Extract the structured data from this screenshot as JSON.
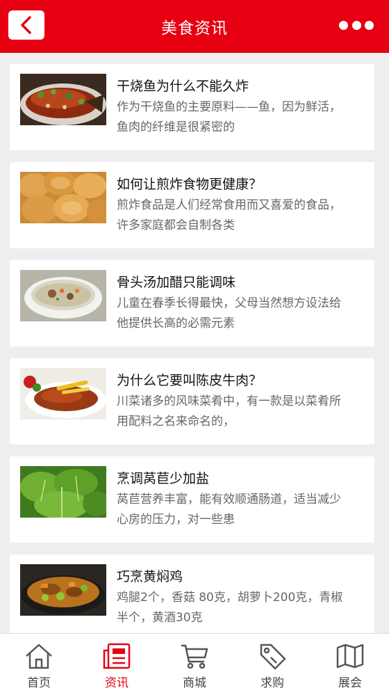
{
  "header": {
    "title": "美食资讯",
    "back_icon": "chevron-left-icon",
    "more_icon": "more-dots-icon"
  },
  "articles": [
    {
      "title": "干烧鱼为什么不能久炸",
      "desc": "作为干烧鱼的主要原料——鱼，因为鲜活，鱼肉的纤维是很紧密的",
      "image": "braised-fish-photo"
    },
    {
      "title": "如何让煎炸食物更健康？",
      "desc": "煎炸食品是人们经常食用而又喜爱的食品，许多家庭都会自制各类",
      "image": "fried-food-photo"
    },
    {
      "title": "骨头汤加醋只能调味",
      "desc": "儿童在春季长得最快，父母当然想方设法给他提供长高的必需元素",
      "image": "bone-soup-photo"
    },
    {
      "title": "为什么它要叫陈皮牛肉？",
      "desc": "川菜诸多的风味菜肴中，有一款是以菜肴所用配料之名来命名的，",
      "image": "tangerine-beef-photo"
    },
    {
      "title": "烹调莴苣少加盐",
      "desc": "莴苣营养丰富，能有效顺通肠道，适当减少心房的压力，对一些患",
      "image": "lettuce-photo"
    },
    {
      "title": "巧烹黄焖鸡",
      "desc": "鸡腿2个，香菇 80克，胡萝卜200克，青椒半个，黄酒30克",
      "image": "braised-chicken-photo"
    }
  ],
  "bottom_nav": [
    {
      "label": "首页",
      "icon": "home-icon",
      "active": false
    },
    {
      "label": "资讯",
      "icon": "news-icon",
      "active": true
    },
    {
      "label": "商城",
      "icon": "cart-icon",
      "active": false
    },
    {
      "label": "求购",
      "icon": "tag-icon",
      "active": false
    },
    {
      "label": "展会",
      "icon": "map-icon",
      "active": false
    }
  ],
  "colors": {
    "brand_red": "#e60012",
    "background": "#eeeeee",
    "title_text": "#111111",
    "desc_text": "#666666"
  }
}
